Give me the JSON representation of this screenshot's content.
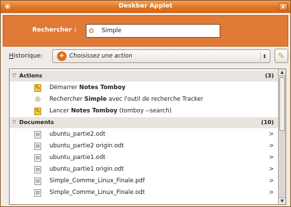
{
  "window": {
    "title": "Deskbar Applet",
    "close_label": "x"
  },
  "search": {
    "label": "Rechercher :",
    "value": "Simple",
    "icon": "deskbar-search-icon"
  },
  "history": {
    "label_first": "H",
    "label_rest": "istorique:",
    "selected": "Choisissez une action",
    "icon": "history-icon",
    "clear_icon": "brush-icon"
  },
  "results": {
    "sections": [
      {
        "name": "Actions",
        "count": "(3)",
        "items": [
          {
            "pre": "Démarrer ",
            "bold": "Notes Tomboy",
            "post": "",
            "icon": "tomboy-note-icon",
            "arrow": ""
          },
          {
            "pre": "Rechercher ",
            "bold": "Simple",
            "post": " avec l'outil de recherche Tracker",
            "icon": "tracker-search-icon",
            "arrow": ""
          },
          {
            "pre": "Lancer ",
            "bold": "Notes Tomboy",
            "post": " (tomboy --search)",
            "icon": "tomboy-note-icon",
            "arrow": ""
          }
        ]
      },
      {
        "name": "Documents",
        "count": "(10)",
        "items": [
          {
            "pre": "ubuntu_partie2.odt",
            "bold": "",
            "post": "",
            "icon": "document-icon",
            "arrow": ">"
          },
          {
            "pre": "ubuntu_partie2 origin.odt",
            "bold": "",
            "post": "",
            "icon": "document-icon",
            "arrow": ">"
          },
          {
            "pre": "ubuntu_partie1.odt",
            "bold": "",
            "post": "",
            "icon": "document-icon",
            "arrow": ">"
          },
          {
            "pre": "ubuntu_partie1 origin.odt",
            "bold": "",
            "post": "",
            "icon": "document-icon",
            "arrow": ">"
          },
          {
            "pre": "Simple_Comme_Linux_Finale.pdf",
            "bold": "",
            "post": "",
            "icon": "document-icon",
            "arrow": ">"
          },
          {
            "pre": "Simple_Comme_Linux_Finale.odt",
            "bold": "",
            "post": "",
            "icon": "document-icon",
            "arrow": ">"
          }
        ]
      }
    ]
  },
  "colors": {
    "accent": "#e07a36",
    "titlebar": "#e0741f"
  }
}
